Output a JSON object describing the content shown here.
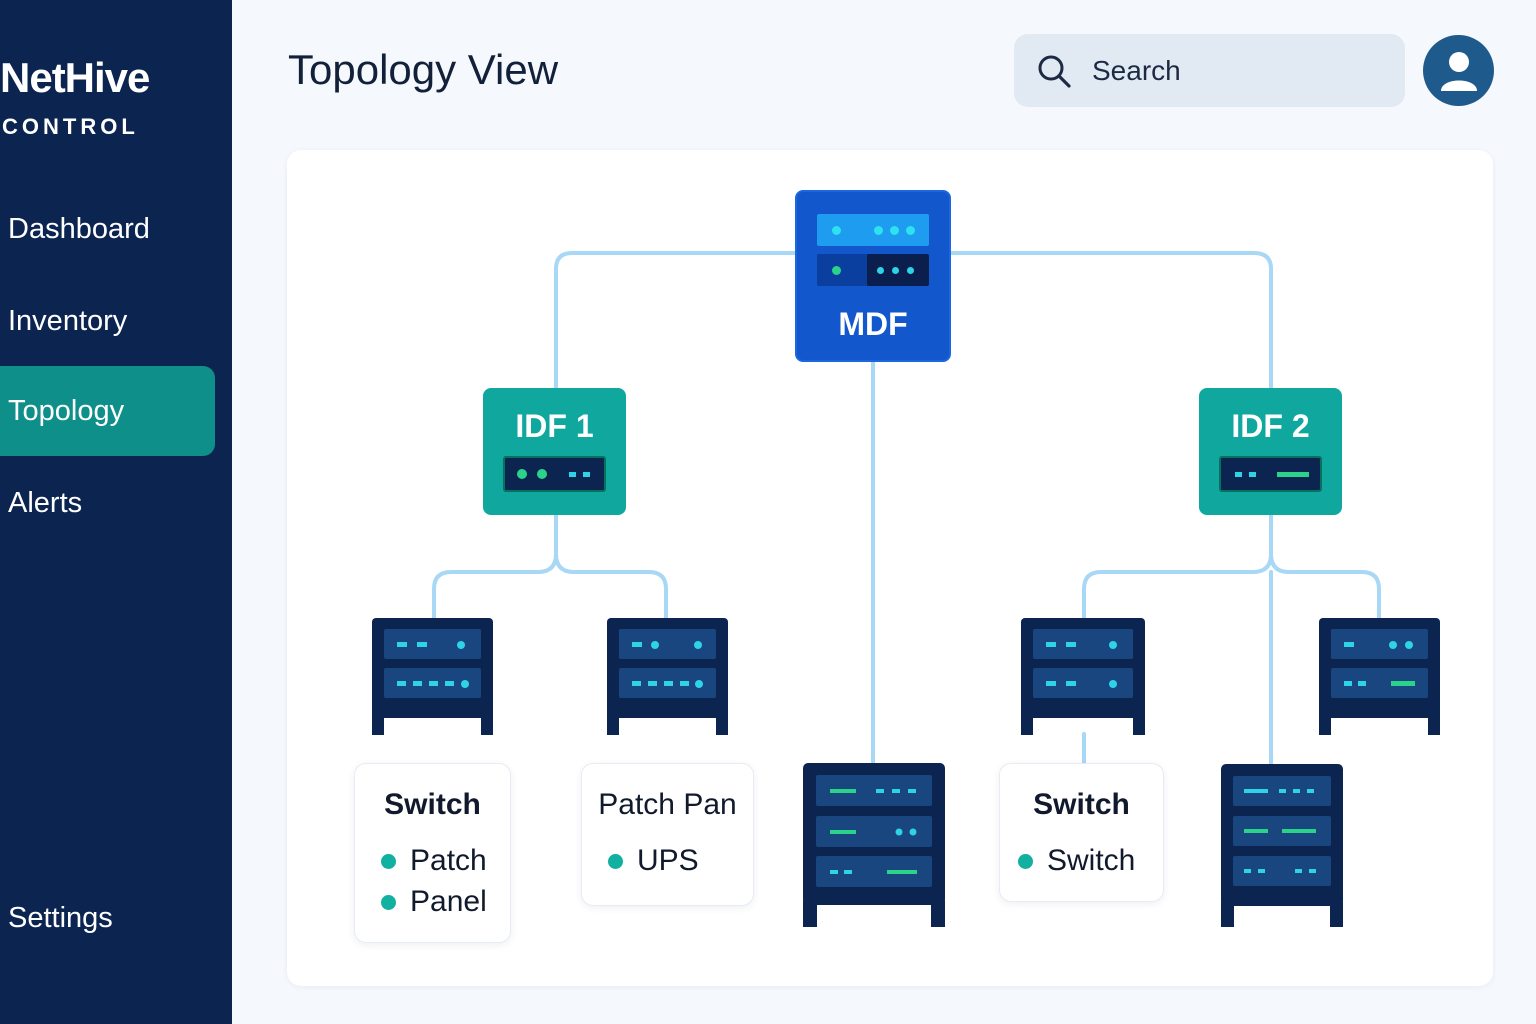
{
  "brand": {
    "name": "NetHive",
    "subtitle": "CONTROL"
  },
  "sidebar": {
    "items": [
      {
        "label": "Dashboard",
        "active": false
      },
      {
        "label": "Inventory",
        "active": false
      },
      {
        "label": "Topology",
        "active": true
      },
      {
        "label": "Alerts",
        "active": false
      }
    ],
    "settings_label": "Settings"
  },
  "header": {
    "title": "Topology View",
    "search_placeholder": "Search",
    "search_icon": "search-icon",
    "avatar_icon": "user-icon"
  },
  "topology": {
    "core": {
      "label": "MDF"
    },
    "distribution": [
      {
        "label": "IDF 1"
      },
      {
        "label": "IDF 2"
      }
    ],
    "cards": [
      {
        "title": "Switch",
        "items": [
          "Patch",
          "Panel"
        ]
      },
      {
        "title": "Patch Pan",
        "items": [
          "UPS"
        ]
      },
      {
        "title": "Switch",
        "items": [
          "Switch"
        ]
      }
    ]
  },
  "colors": {
    "sidebar_bg": "#0c2450",
    "active_nav": "#0f8f8a",
    "mdf": "#1257cc",
    "idf": "#10a89e",
    "rack": "#0c2450",
    "link": "#a8d8f5",
    "led_cyan": "#2fd3e8",
    "led_green": "#2bd38a"
  }
}
